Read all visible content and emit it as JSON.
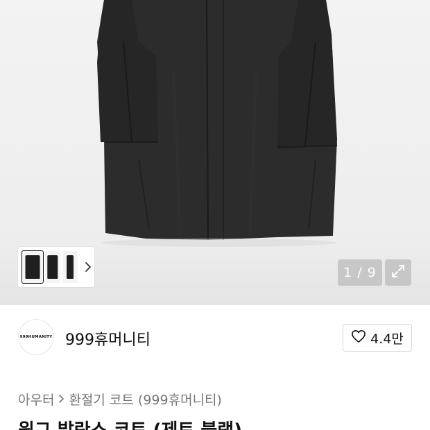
{
  "gallery": {
    "image_alt": "black coat product photo",
    "counter": "1 / 9",
    "icons": {
      "next": "chevron-right-icon",
      "expand": "expand-arrows-icon"
    }
  },
  "brand": {
    "logo_text": "999HUMANITY",
    "name": "999휴머니티",
    "likes": "4.4만",
    "like_icon": "heart-outline-icon"
  },
  "breadcrumb": {
    "category": "아우터",
    "subcategory": "환절기 코트 (999휴머니티)"
  },
  "product": {
    "title": "윙그 발란스 코트 (제트 블랙)"
  }
}
